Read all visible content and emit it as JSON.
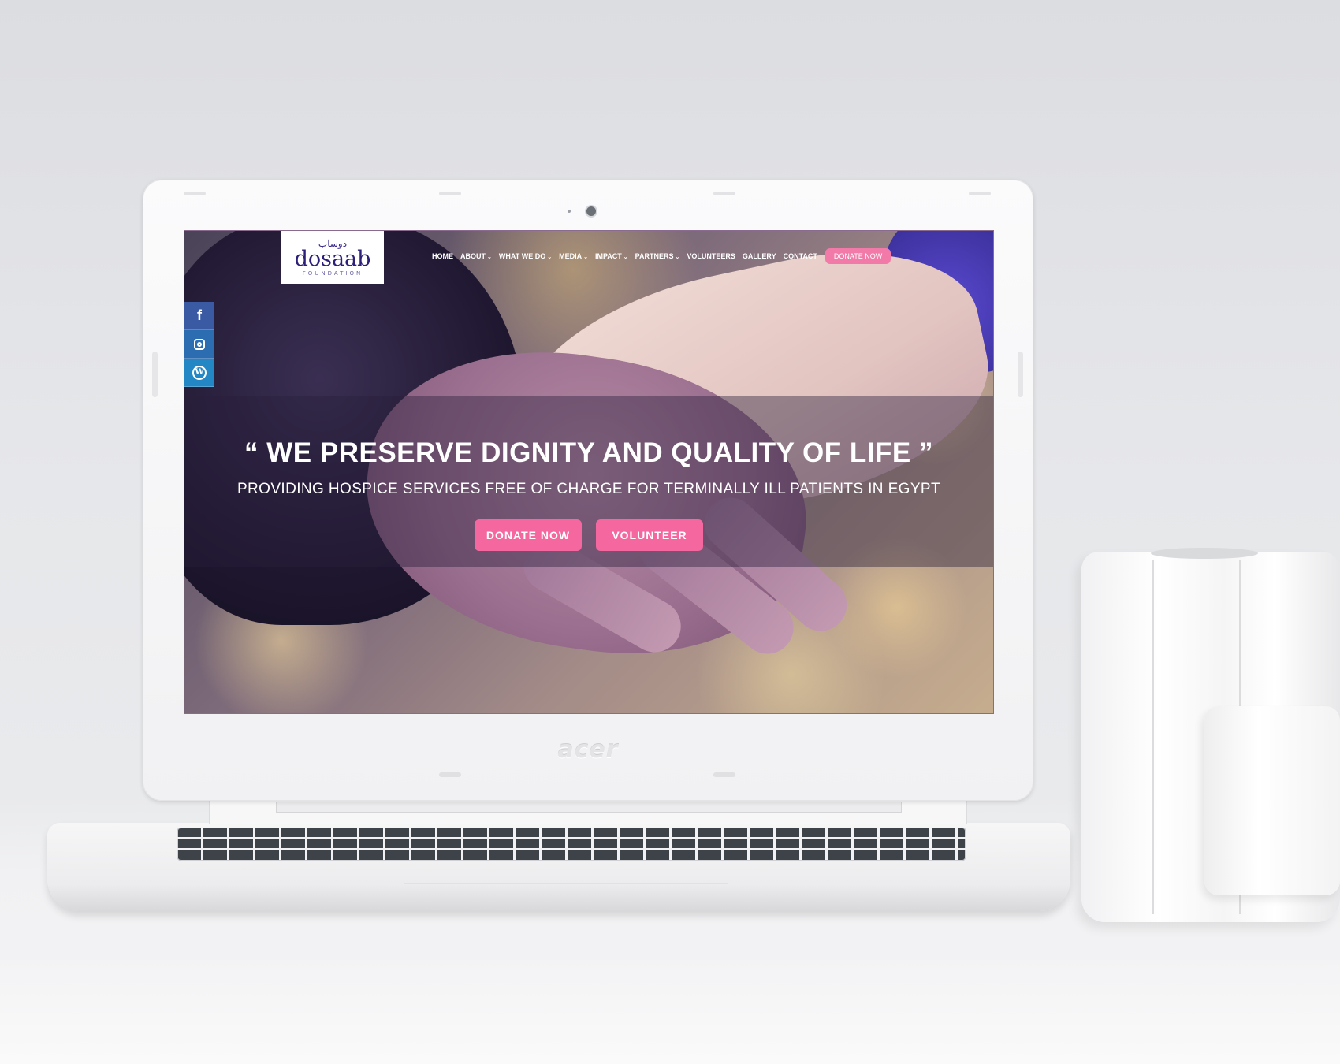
{
  "site": {
    "logo": {
      "arabic": "دوساب",
      "name": "dosaab",
      "subtitle": "FOUNDATION"
    },
    "nav": {
      "items": [
        {
          "label": "HOME",
          "has_dropdown": false
        },
        {
          "label": "ABOUT",
          "has_dropdown": true
        },
        {
          "label": "WHAT WE DO",
          "has_dropdown": true
        },
        {
          "label": "MEDIA",
          "has_dropdown": true
        },
        {
          "label": "IMPACT",
          "has_dropdown": true
        },
        {
          "label": "PARTNERS",
          "has_dropdown": true
        },
        {
          "label": "VOLUNTEERS",
          "has_dropdown": false
        },
        {
          "label": "GALLERY",
          "has_dropdown": false
        },
        {
          "label": "CONTACT",
          "has_dropdown": false
        }
      ],
      "donate_label": "DONATE NOW",
      "chevron": "⌄"
    },
    "social": [
      {
        "icon": "facebook-icon",
        "glyph": "f"
      },
      {
        "icon": "instagram-icon",
        "glyph": ""
      },
      {
        "icon": "wordpress-icon",
        "glyph": "W"
      }
    ],
    "hero": {
      "headline": "“ WE PRESERVE DIGNITY AND QUALITY OF LIFE ”",
      "subline": "PROVIDING HOSPICE SERVICES FREE OF CHARGE FOR TERMINALLY ILL PATIENTS IN EGYPT",
      "primary_button": "DONATE NOW",
      "secondary_button": "VOLUNTEER"
    }
  },
  "device": {
    "brand": "acer"
  },
  "colors": {
    "accent_pink": "#f5679f",
    "facebook": "#3a5aa4",
    "instagram": "#2c6cb0",
    "wordpress": "#2487c5",
    "logo_navy": "#2b1f7a"
  }
}
